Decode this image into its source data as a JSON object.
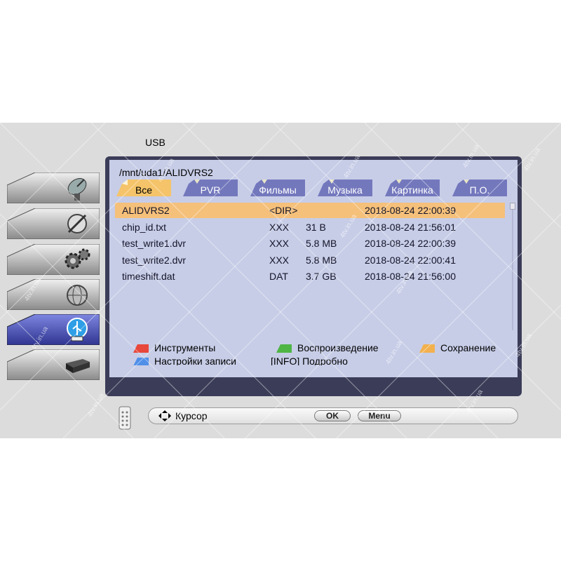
{
  "screen": {
    "title": "USB"
  },
  "menu": {
    "items": [
      {
        "icon": "satellite-icon"
      },
      {
        "icon": "tools-icon"
      },
      {
        "icon": "gears-icon"
      },
      {
        "icon": "globe-icon"
      },
      {
        "icon": "usb-icon",
        "active": true
      },
      {
        "icon": "receiver-icon"
      }
    ]
  },
  "browser": {
    "path": "/mnt/uda1/ALIDVRS2",
    "tabs": [
      {
        "label": "Все",
        "active": true
      },
      {
        "label": "PVR"
      },
      {
        "label": "Фильмы"
      },
      {
        "label": "Музыка"
      },
      {
        "label": "Картинка"
      },
      {
        "label": "П.О."
      }
    ],
    "files": [
      {
        "name": "ALIDVRS2",
        "type": "<DIR>",
        "size": "",
        "date": "2018-08-24 22:00:39",
        "selected": true
      },
      {
        "name": "chip_id.txt",
        "type": "XXX",
        "size": "31 B",
        "date": "2018-08-24 21:56:01"
      },
      {
        "name": "test_write1.dvr",
        "type": "XXX",
        "size": "5.8 MB",
        "date": "2018-08-24 22:00:39"
      },
      {
        "name": "test_write2.dvr",
        "type": "XXX",
        "size": "5.8 MB",
        "date": "2018-08-24 22:00:41"
      },
      {
        "name": "timeshift.dat",
        "type": "DAT",
        "size": "3.7 GB",
        "date": "2018-08-24 21:56:00"
      }
    ],
    "legend": {
      "red": "Инструменты",
      "green": "Воспроизведение",
      "yellow": "Сохранение",
      "blue": "Настройки записи",
      "info": "[INFO]  Подробно"
    }
  },
  "help_bar": {
    "cursor_label": "Курсор",
    "ok_label": "OK",
    "menu_label": "Menu"
  },
  "watermark": "4tv.in.ua",
  "colors": {
    "panel_dark": "#3b3c58",
    "panel_inner": "#c7cde7",
    "selection": "#f5c07a",
    "tab_active": "#f5c46a",
    "tab_inactive": "#7378bd",
    "menu_active": "#4b53b5",
    "red_key": "#e8473b",
    "green_key": "#4fb545",
    "yellow_key": "#f2b14e",
    "blue_key": "#4f8fe8"
  }
}
